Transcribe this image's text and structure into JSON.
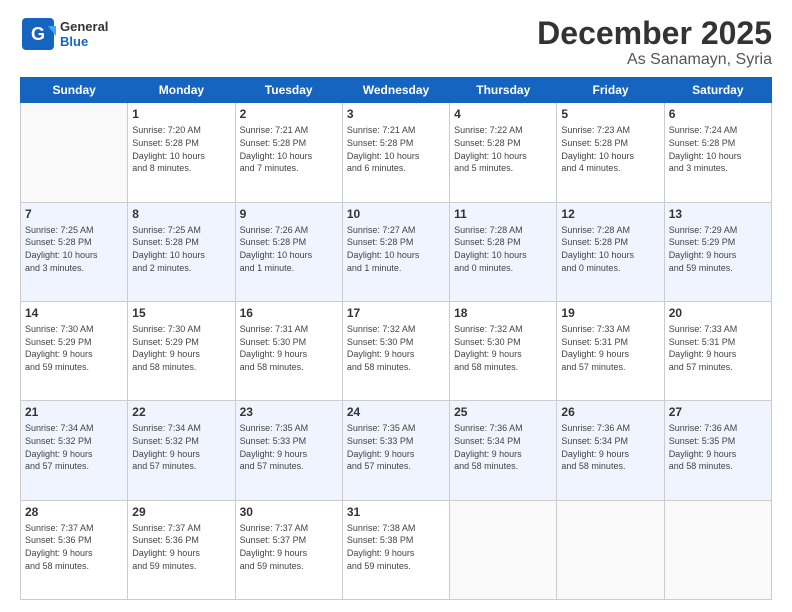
{
  "header": {
    "logo_general": "General",
    "logo_blue": "Blue",
    "title": "December 2025",
    "subtitle": "As Sanamayn, Syria"
  },
  "days_of_week": [
    "Sunday",
    "Monday",
    "Tuesday",
    "Wednesday",
    "Thursday",
    "Friday",
    "Saturday"
  ],
  "weeks": [
    [
      {
        "day": "",
        "info": ""
      },
      {
        "day": "1",
        "info": "Sunrise: 7:20 AM\nSunset: 5:28 PM\nDaylight: 10 hours\nand 8 minutes."
      },
      {
        "day": "2",
        "info": "Sunrise: 7:21 AM\nSunset: 5:28 PM\nDaylight: 10 hours\nand 7 minutes."
      },
      {
        "day": "3",
        "info": "Sunrise: 7:21 AM\nSunset: 5:28 PM\nDaylight: 10 hours\nand 6 minutes."
      },
      {
        "day": "4",
        "info": "Sunrise: 7:22 AM\nSunset: 5:28 PM\nDaylight: 10 hours\nand 5 minutes."
      },
      {
        "day": "5",
        "info": "Sunrise: 7:23 AM\nSunset: 5:28 PM\nDaylight: 10 hours\nand 4 minutes."
      },
      {
        "day": "6",
        "info": "Sunrise: 7:24 AM\nSunset: 5:28 PM\nDaylight: 10 hours\nand 3 minutes."
      }
    ],
    [
      {
        "day": "7",
        "info": "Sunrise: 7:25 AM\nSunset: 5:28 PM\nDaylight: 10 hours\nand 3 minutes."
      },
      {
        "day": "8",
        "info": "Sunrise: 7:25 AM\nSunset: 5:28 PM\nDaylight: 10 hours\nand 2 minutes."
      },
      {
        "day": "9",
        "info": "Sunrise: 7:26 AM\nSunset: 5:28 PM\nDaylight: 10 hours\nand 1 minute."
      },
      {
        "day": "10",
        "info": "Sunrise: 7:27 AM\nSunset: 5:28 PM\nDaylight: 10 hours\nand 1 minute."
      },
      {
        "day": "11",
        "info": "Sunrise: 7:28 AM\nSunset: 5:28 PM\nDaylight: 10 hours\nand 0 minutes."
      },
      {
        "day": "12",
        "info": "Sunrise: 7:28 AM\nSunset: 5:28 PM\nDaylight: 10 hours\nand 0 minutes."
      },
      {
        "day": "13",
        "info": "Sunrise: 7:29 AM\nSunset: 5:29 PM\nDaylight: 9 hours\nand 59 minutes."
      }
    ],
    [
      {
        "day": "14",
        "info": "Sunrise: 7:30 AM\nSunset: 5:29 PM\nDaylight: 9 hours\nand 59 minutes."
      },
      {
        "day": "15",
        "info": "Sunrise: 7:30 AM\nSunset: 5:29 PM\nDaylight: 9 hours\nand 58 minutes."
      },
      {
        "day": "16",
        "info": "Sunrise: 7:31 AM\nSunset: 5:30 PM\nDaylight: 9 hours\nand 58 minutes."
      },
      {
        "day": "17",
        "info": "Sunrise: 7:32 AM\nSunset: 5:30 PM\nDaylight: 9 hours\nand 58 minutes."
      },
      {
        "day": "18",
        "info": "Sunrise: 7:32 AM\nSunset: 5:30 PM\nDaylight: 9 hours\nand 58 minutes."
      },
      {
        "day": "19",
        "info": "Sunrise: 7:33 AM\nSunset: 5:31 PM\nDaylight: 9 hours\nand 57 minutes."
      },
      {
        "day": "20",
        "info": "Sunrise: 7:33 AM\nSunset: 5:31 PM\nDaylight: 9 hours\nand 57 minutes."
      }
    ],
    [
      {
        "day": "21",
        "info": "Sunrise: 7:34 AM\nSunset: 5:32 PM\nDaylight: 9 hours\nand 57 minutes."
      },
      {
        "day": "22",
        "info": "Sunrise: 7:34 AM\nSunset: 5:32 PM\nDaylight: 9 hours\nand 57 minutes."
      },
      {
        "day": "23",
        "info": "Sunrise: 7:35 AM\nSunset: 5:33 PM\nDaylight: 9 hours\nand 57 minutes."
      },
      {
        "day": "24",
        "info": "Sunrise: 7:35 AM\nSunset: 5:33 PM\nDaylight: 9 hours\nand 57 minutes."
      },
      {
        "day": "25",
        "info": "Sunrise: 7:36 AM\nSunset: 5:34 PM\nDaylight: 9 hours\nand 58 minutes."
      },
      {
        "day": "26",
        "info": "Sunrise: 7:36 AM\nSunset: 5:34 PM\nDaylight: 9 hours\nand 58 minutes."
      },
      {
        "day": "27",
        "info": "Sunrise: 7:36 AM\nSunset: 5:35 PM\nDaylight: 9 hours\nand 58 minutes."
      }
    ],
    [
      {
        "day": "28",
        "info": "Sunrise: 7:37 AM\nSunset: 5:36 PM\nDaylight: 9 hours\nand 58 minutes."
      },
      {
        "day": "29",
        "info": "Sunrise: 7:37 AM\nSunset: 5:36 PM\nDaylight: 9 hours\nand 59 minutes."
      },
      {
        "day": "30",
        "info": "Sunrise: 7:37 AM\nSunset: 5:37 PM\nDaylight: 9 hours\nand 59 minutes."
      },
      {
        "day": "31",
        "info": "Sunrise: 7:38 AM\nSunset: 5:38 PM\nDaylight: 9 hours\nand 59 minutes."
      },
      {
        "day": "",
        "info": ""
      },
      {
        "day": "",
        "info": ""
      },
      {
        "day": "",
        "info": ""
      }
    ]
  ]
}
